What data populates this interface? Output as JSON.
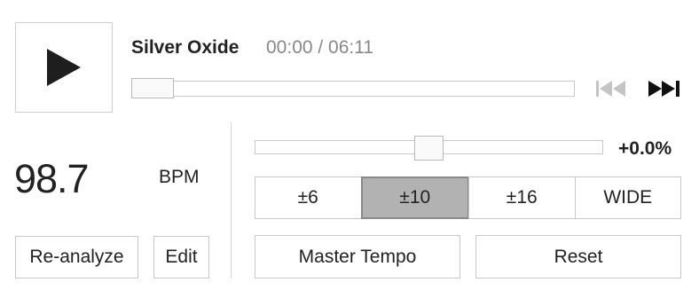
{
  "player": {
    "play_icon": "play-icon",
    "title": "Silver Oxide",
    "time": "00:00 / 06:11",
    "progress_fraction": 0.0,
    "prev_icon": "skip-back-icon",
    "next_icon": "skip-forward-icon",
    "prev_enabled": false
  },
  "tempo": {
    "bpm_value": "98.7",
    "bpm_label": "BPM",
    "reanalyze_label": "Re-analyze",
    "edit_label": "Edit",
    "pitch_value": "+0.0%",
    "pitch_fraction": 0.5,
    "ranges": [
      {
        "label": "±6",
        "active": false
      },
      {
        "label": "±10",
        "active": true
      },
      {
        "label": "±16",
        "active": false
      },
      {
        "label": "WIDE",
        "active": false
      }
    ],
    "master_tempo_label": "Master Tempo",
    "reset_label": "Reset"
  },
  "colors": {
    "active_segment": "#b2b2b2",
    "disabled_icon": "#c4c4c4",
    "text": "#222222",
    "muted_text": "#888888"
  }
}
